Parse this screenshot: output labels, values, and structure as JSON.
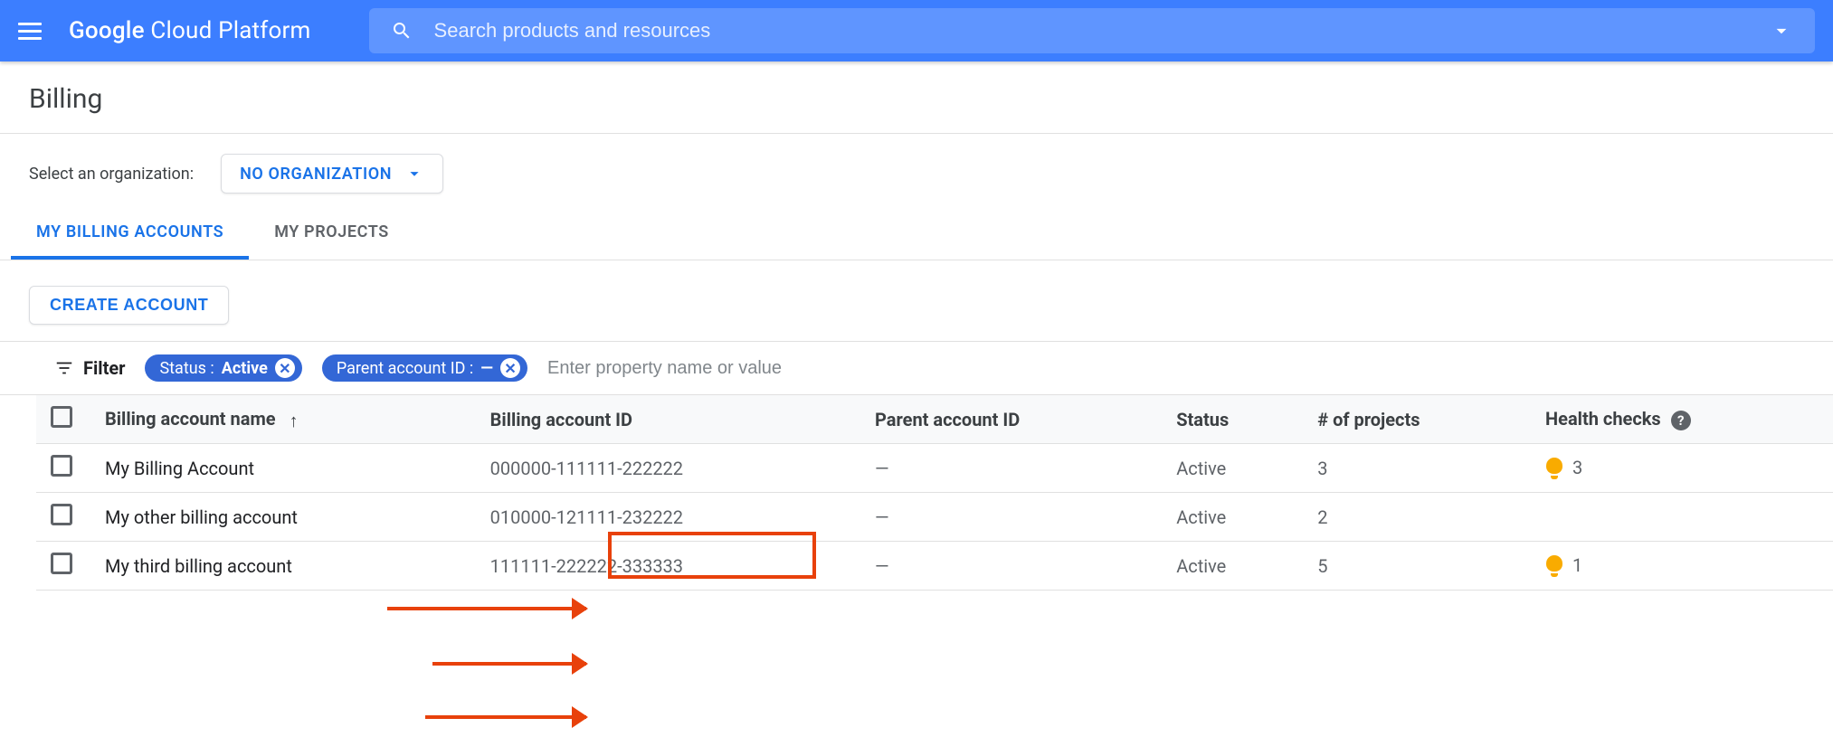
{
  "header": {
    "brand_a": "Google",
    "brand_b": "Cloud Platform",
    "search_placeholder": "Search products and resources"
  },
  "page": {
    "title": "Billing",
    "org_label": "Select an organization:",
    "org_value": "NO ORGANIZATION"
  },
  "tabs": {
    "billing": "MY BILLING ACCOUNTS",
    "projects": "MY PROJECTS"
  },
  "actions": {
    "create": "CREATE ACCOUNT"
  },
  "filter": {
    "label": "Filter",
    "chip1_key": "Status : ",
    "chip1_val": "Active",
    "chip2_key": "Parent account ID : ",
    "chip2_val": "—",
    "placeholder": "Enter property name or value"
  },
  "table": {
    "cols": {
      "name": "Billing account name",
      "id": "Billing account ID",
      "parent": "Parent account ID",
      "status": "Status",
      "projects": "# of projects",
      "health": "Health checks"
    },
    "rows": [
      {
        "name": "My Billing Account",
        "id": "000000-111111-222222",
        "parent": "—",
        "status": "Active",
        "projects": "3",
        "health": "3"
      },
      {
        "name": "My other billing account",
        "id": "010000-121111-232222",
        "parent": "—",
        "status": "Active",
        "projects": "2",
        "health": ""
      },
      {
        "name": "My third billing account",
        "id": "111111-222222-333333",
        "parent": "—",
        "status": "Active",
        "projects": "5",
        "health": "1"
      }
    ]
  }
}
